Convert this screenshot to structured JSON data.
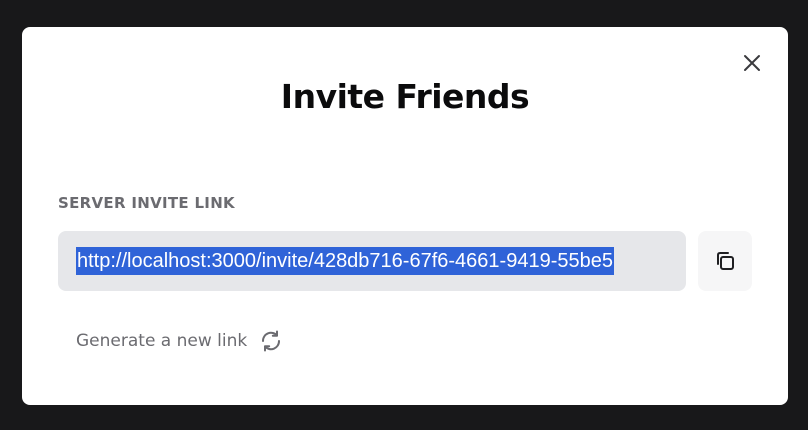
{
  "dialog": {
    "title": "Invite Friends",
    "section_label": "SERVER INVITE LINK",
    "invite_link": "http://localhost:3000/invite/428db716-67f6-4661-9419-55be5",
    "regenerate_label": "Generate a new link"
  },
  "icons": {
    "close": "close-icon",
    "copy": "copy-icon",
    "refresh": "refresh-icon"
  },
  "colors": {
    "backdrop": "#18181a",
    "modal_bg": "#ffffff",
    "title": "#0b0b0c",
    "muted_text": "#6b6b70",
    "input_bg": "#e6e7ea",
    "selection": "#2f63d8"
  }
}
